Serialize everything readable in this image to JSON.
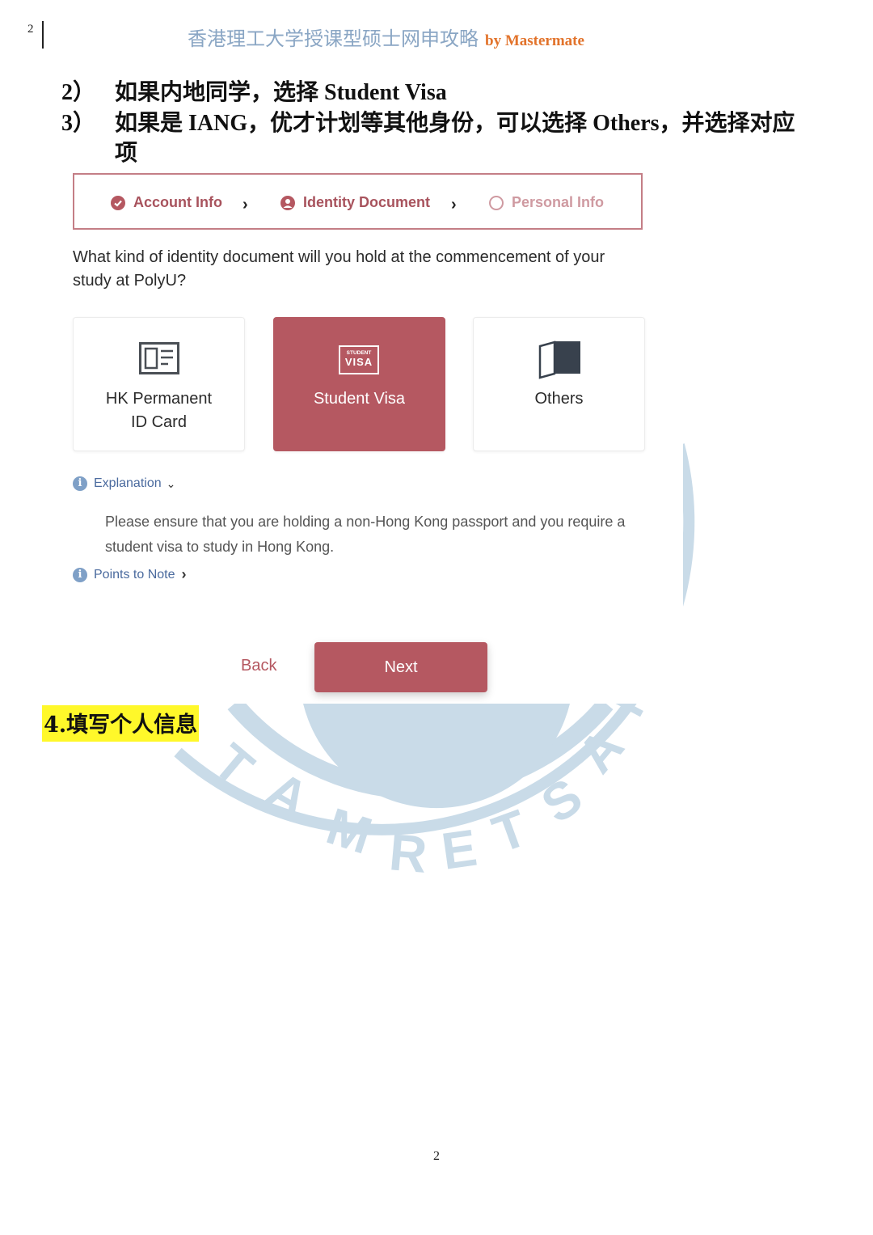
{
  "header": {
    "page_number": "2",
    "title": "香港理工大学授课型硕士网申攻略",
    "brand": "by Mastermate"
  },
  "instructions": [
    {
      "num": "2）",
      "text": "如果内地同学，选择 Student Visa"
    },
    {
      "num": "3）",
      "text": "如果是  IANG，优才计划等其他身份，可以选择  Others，并选择对应"
    },
    {
      "num": "",
      "text": "项"
    }
  ],
  "screenshot": {
    "stepper": {
      "steps": [
        {
          "label": "Account Info",
          "state": "completed",
          "icon": "check-circle-icon"
        },
        {
          "label": "Identity Document",
          "state": "current",
          "icon": "user-circle-icon"
        },
        {
          "label": "Personal Info",
          "state": "pending",
          "icon": "empty-circle-icon"
        }
      ],
      "separator_icon": "chevron-right-icon"
    },
    "question": "What kind of identity document will you hold at the commencement of your study at PolyU?",
    "options": [
      {
        "label": "HK Permanent ID Card",
        "line1": "HK Permanent",
        "line2": "ID Card",
        "icon": "id-card-icon",
        "selected": false
      },
      {
        "label": "Student Visa",
        "line1": "Student Visa",
        "line2": "",
        "icon": "student-visa-icon",
        "icon_text_top": "STUDENT",
        "icon_text_bottom": "VISA",
        "selected": true
      },
      {
        "label": "Others",
        "line1": "Others",
        "line2": "",
        "icon": "open-door-icon",
        "selected": false
      }
    ],
    "explanation": {
      "label": "Explanation",
      "expanded": true,
      "text": "Please ensure that you are holding a non-Hong Kong passport and you require a student visa to study in Hong Kong."
    },
    "points_to_note": {
      "label": "Points to Note",
      "expanded": false
    },
    "back_label": "Back",
    "next_label": "Next"
  },
  "section_heading": "4.填写个人信息",
  "watermark_text": "MASTERMATE",
  "footer": {
    "page_number": "2"
  },
  "colors": {
    "accent": "#b55861",
    "stepper_border": "#c47e86",
    "link_blue": "#4a6a9e",
    "header_title": "#8aa6c4",
    "brand_orange": "#e2732b",
    "highlight": "#fff82a",
    "watermark": "#c9dbe8"
  }
}
